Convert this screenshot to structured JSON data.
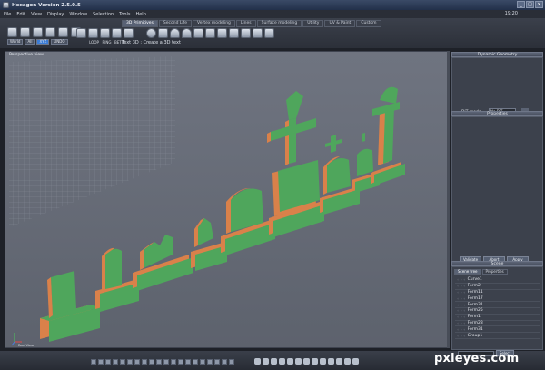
{
  "window": {
    "title": "Hexagon Version 2.5.0.5",
    "controls": [
      "_",
      "□",
      "×"
    ]
  },
  "menu": [
    "File",
    "Edit",
    "View",
    "Display",
    "Window",
    "Selection",
    "Tools",
    "Help"
  ],
  "clock": "19:20",
  "toolbar": {
    "coord_mode": "World",
    "small_buttons": [
      "World",
      "All",
      "XYZ",
      "UNDO"
    ],
    "tabs": [
      "3D Primitives",
      "Second Life",
      "Vertex modeling",
      "Lines",
      "Surface modeling",
      "Utility",
      "UV & Paint",
      "Custom"
    ],
    "active_tab": 0,
    "mod_labels": [
      "",
      "LOOP",
      "RING",
      "BETW",
      ""
    ],
    "status": "Text 3D : Create a 3D text"
  },
  "viewport": {
    "label": "Perspective view",
    "axis_label": "Real View"
  },
  "panels": {
    "dynamic": {
      "title": "Dynamic Geometry",
      "dit_label": "DiT mode",
      "dit_value": "No DiT"
    },
    "properties": {
      "title": "Properties",
      "buttons": [
        "Validate",
        "Abort",
        "Apply"
      ]
    },
    "scene": {
      "title": "Scene",
      "tabs": [
        "Scene tree",
        "Properties"
      ],
      "items": [
        "Curve1",
        "Form2",
        "Form11",
        "Form17",
        "Form31",
        "Form25",
        "Form1",
        "Form28",
        "Form31",
        "Group1"
      ],
      "select_label": "Select"
    }
  },
  "watermark": "pxleyes.com",
  "colors": {
    "background": "#1e2128",
    "viewport": "#676c78",
    "grave_face": "#4fa65c",
    "grave_side": "#d9814a",
    "highlight": "#3a7bd5"
  }
}
